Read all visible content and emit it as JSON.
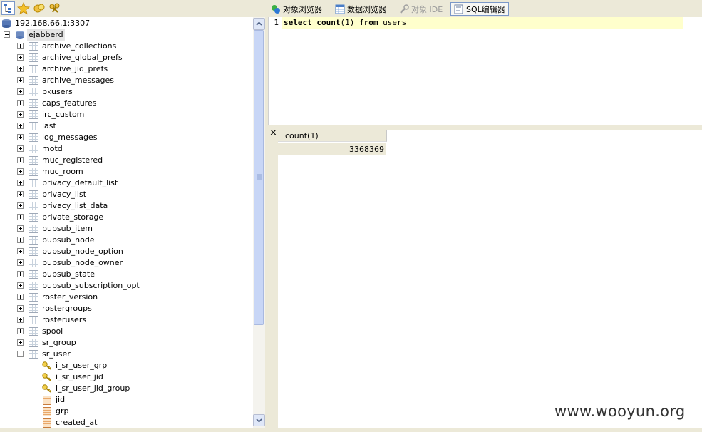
{
  "tabs": [
    {
      "label": "对象浏览器"
    },
    {
      "label": "数据浏览器"
    },
    {
      "label": "对象 IDE"
    },
    {
      "label": "SQL编辑器"
    }
  ],
  "tree": {
    "server": "192.168.66.1:3307",
    "database": "ejabberd",
    "tables": [
      "archive_collections",
      "archive_global_prefs",
      "archive_jid_prefs",
      "archive_messages",
      "bkusers",
      "caps_features",
      "irc_custom",
      "last",
      "log_messages",
      "motd",
      "muc_registered",
      "muc_room",
      "privacy_default_list",
      "privacy_list",
      "privacy_list_data",
      "private_storage",
      "pubsub_item",
      "pubsub_node",
      "pubsub_node_option",
      "pubsub_node_owner",
      "pubsub_state",
      "pubsub_subscription_opt",
      "roster_version",
      "rostergroups",
      "rosterusers",
      "spool",
      "sr_group",
      "sr_user"
    ],
    "indexes": [
      "i_sr_user_grp",
      "i_sr_user_jid",
      "i_sr_user_jid_group"
    ],
    "columns": [
      "jid",
      "grp",
      "created_at"
    ]
  },
  "editor": {
    "line_number": "1",
    "tokens": [
      {
        "text": "select",
        "kw": true
      },
      {
        "text": " ",
        "kw": false
      },
      {
        "text": "count",
        "kw": true
      },
      {
        "text": "(1) ",
        "kw": false
      },
      {
        "text": "from",
        "kw": true
      },
      {
        "text": " users",
        "kw": false
      }
    ]
  },
  "results": {
    "close_label": "×",
    "column_header": "count(1)",
    "value": "3368369"
  },
  "watermark": "www.wooyun.org"
}
